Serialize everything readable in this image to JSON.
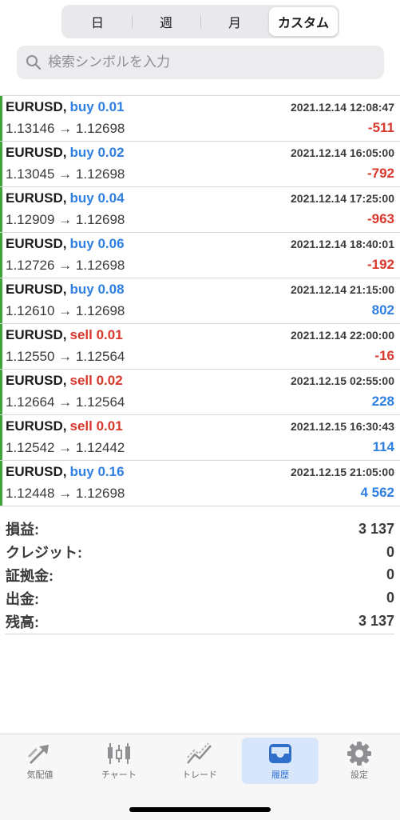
{
  "period_tabs": [
    "日",
    "週",
    "月",
    "カスタム"
  ],
  "search": {
    "placeholder": "検索シンボルを入力"
  },
  "deals": [
    {
      "symbol": "EURUSD,",
      "type": "buy",
      "volume_text": "buy 0.01",
      "time": "2021.12.14 12:08:47",
      "prices": "1.13146 → 1.12698",
      "profit": "-511"
    },
    {
      "symbol": "EURUSD,",
      "type": "buy",
      "volume_text": "buy 0.02",
      "time": "2021.12.14 16:05:00",
      "prices": "1.13045 → 1.12698",
      "profit": "-792"
    },
    {
      "symbol": "EURUSD,",
      "type": "buy",
      "volume_text": "buy 0.04",
      "time": "2021.12.14 17:25:00",
      "prices": "1.12909 → 1.12698",
      "profit": "-963"
    },
    {
      "symbol": "EURUSD,",
      "type": "buy",
      "volume_text": "buy 0.06",
      "time": "2021.12.14 18:40:01",
      "prices": "1.12726 → 1.12698",
      "profit": "-192"
    },
    {
      "symbol": "EURUSD,",
      "type": "buy",
      "volume_text": "buy 0.08",
      "time": "2021.12.14 21:15:00",
      "prices": "1.12610 → 1.12698",
      "profit": "802"
    },
    {
      "symbol": "EURUSD,",
      "type": "sell",
      "volume_text": "sell 0.01",
      "time": "2021.12.14 22:00:00",
      "prices": "1.12550 → 1.12564",
      "profit": "-16"
    },
    {
      "symbol": "EURUSD,",
      "type": "sell",
      "volume_text": "sell 0.02",
      "time": "2021.12.15 02:55:00",
      "prices": "1.12664 → 1.12564",
      "profit": "228"
    },
    {
      "symbol": "EURUSD,",
      "type": "sell",
      "volume_text": "sell 0.01",
      "time": "2021.12.15 16:30:43",
      "prices": "1.12542 → 1.12442",
      "profit": "114"
    },
    {
      "symbol": "EURUSD,",
      "type": "buy",
      "volume_text": "buy 0.16",
      "time": "2021.12.15 21:05:00",
      "prices": "1.12448 → 1.12698",
      "profit": "4 562"
    }
  ],
  "summary": [
    {
      "label": "損益:",
      "value": "3 137"
    },
    {
      "label": "クレジット:",
      "value": "0"
    },
    {
      "label": "証拠金:",
      "value": "0"
    },
    {
      "label": "出金:",
      "value": "0"
    },
    {
      "label": "残高:",
      "value": "3 137"
    }
  ],
  "tabbar": [
    {
      "label": "気配値",
      "icon": "quotes-arrows-icon"
    },
    {
      "label": "チャート",
      "icon": "candlestick-chart-icon"
    },
    {
      "label": "トレード",
      "icon": "trade-line-icon"
    },
    {
      "label": "履歴",
      "icon": "inbox-tray-icon",
      "active": true
    },
    {
      "label": "設定",
      "icon": "gear-icon"
    }
  ],
  "colors": {
    "buy": "#2f7fe0",
    "sell": "#d9382c",
    "profit_positive": "#2f7fe0",
    "profit_negative": "#d9382c",
    "row_marker": "#3fa33a",
    "active_tab_bg": "#d7e6fb"
  }
}
